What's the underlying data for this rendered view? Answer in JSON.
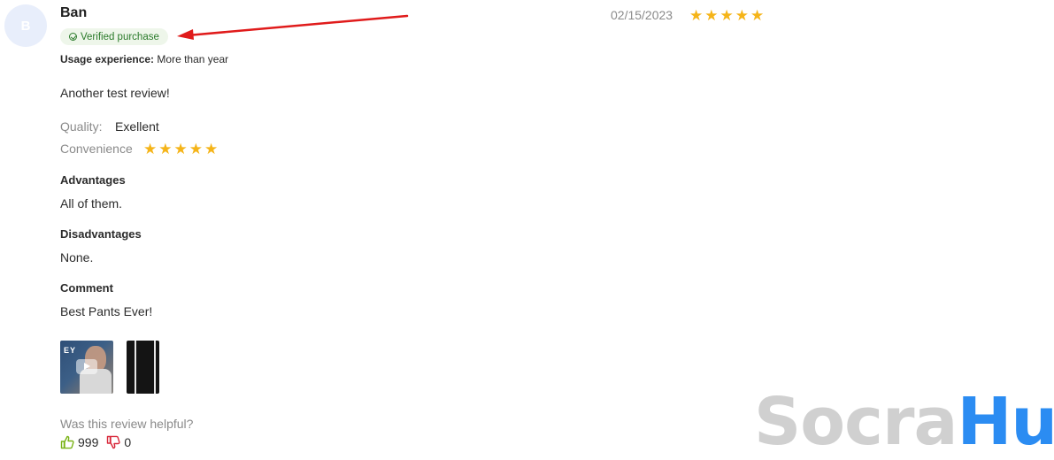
{
  "review": {
    "avatar_letter": "B",
    "author": "Ban",
    "verified_label": "Verified purchase",
    "usage_label": "Usage experience:",
    "usage_value": "More than year",
    "date": "02/15/2023",
    "rating": 5,
    "text": "Another test review!",
    "quality_label": "Quality:",
    "quality_value": "Exellent",
    "convenience_label": "Convenience",
    "convenience_rating": 5,
    "advantages_title": "Advantages",
    "advantages_text": "All of them.",
    "disadvantages_title": "Disadvantages",
    "disadvantages_text": "None.",
    "comment_title": "Comment",
    "comment_text": "Best Pants Ever!",
    "media_video_text": "EY",
    "helpful_question": "Was this review helpful?",
    "likes": "999",
    "dislikes": "0"
  },
  "colors": {
    "star": "#f5b418",
    "verified_bg": "#eef6ea",
    "verified_text": "#2a7a2a",
    "arrow": "#e01b1b",
    "like": "#7ab317",
    "dislike": "#d8283a"
  },
  "watermark": {
    "part1": "Socra",
    "part2": "Hub"
  }
}
